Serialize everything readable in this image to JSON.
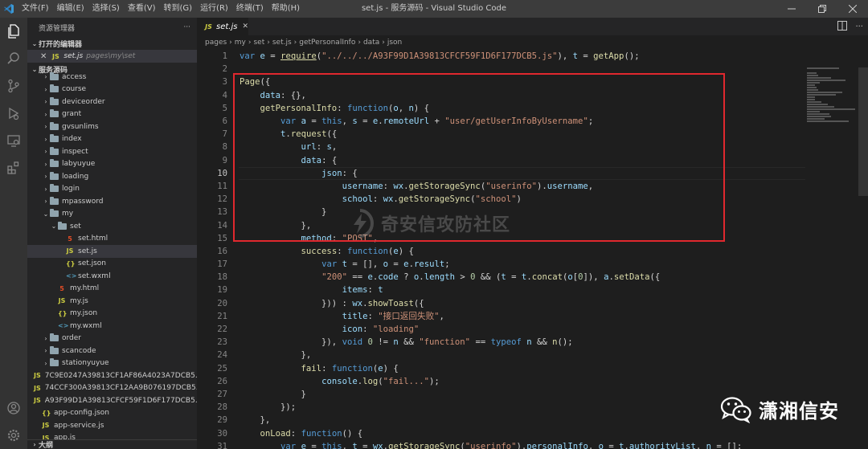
{
  "titlebar": {
    "menu": [
      "文件(F)",
      "编辑(E)",
      "选择(S)",
      "查看(V)",
      "转到(G)",
      "运行(R)",
      "终端(T)",
      "帮助(H)"
    ],
    "title": "set.js - 服务源码 - Visual Studio Code"
  },
  "sidebar": {
    "header": "资源管理器",
    "more": "···",
    "open_editors_label": "打开的编辑器",
    "open_editor": {
      "name": "set.js",
      "path": "pages\\my\\set"
    },
    "workspace_label": "服务源码",
    "tree": [
      {
        "label": "access",
        "type": "folder",
        "depth": 1
      },
      {
        "label": "course",
        "type": "folder",
        "depth": 1
      },
      {
        "label": "deviceorder",
        "type": "folder",
        "depth": 1
      },
      {
        "label": "grant",
        "type": "folder",
        "depth": 1
      },
      {
        "label": "gvsunlims",
        "type": "folder",
        "depth": 1
      },
      {
        "label": "index",
        "type": "folder",
        "depth": 1
      },
      {
        "label": "inspect",
        "type": "folder",
        "depth": 1
      },
      {
        "label": "labyuyue",
        "type": "folder",
        "depth": 1
      },
      {
        "label": "loading",
        "type": "folder",
        "depth": 1
      },
      {
        "label": "login",
        "type": "folder",
        "depth": 1
      },
      {
        "label": "mpassword",
        "type": "folder",
        "depth": 1
      },
      {
        "label": "my",
        "type": "folder-open",
        "depth": 1
      },
      {
        "label": "set",
        "type": "folder-open",
        "depth": 2
      },
      {
        "label": "set.html",
        "type": "html",
        "depth": 3
      },
      {
        "label": "set.js",
        "type": "js",
        "depth": 3,
        "selected": true
      },
      {
        "label": "set.json",
        "type": "json",
        "depth": 3
      },
      {
        "label": "set.wxml",
        "type": "wxml",
        "depth": 3
      },
      {
        "label": "my.html",
        "type": "html",
        "depth": 2
      },
      {
        "label": "my.js",
        "type": "js",
        "depth": 2
      },
      {
        "label": "my.json",
        "type": "json",
        "depth": 2
      },
      {
        "label": "my.wxml",
        "type": "wxml",
        "depth": 2
      },
      {
        "label": "order",
        "type": "folder",
        "depth": 1
      },
      {
        "label": "scancode",
        "type": "folder",
        "depth": 1
      },
      {
        "label": "stationyuyue",
        "type": "folder",
        "depth": 1
      },
      {
        "label": "7C9E0247A39813CF1AF86A4023A7DCB5...",
        "type": "js",
        "depth": 0
      },
      {
        "label": "74CCF300A39813CF12AA9B076197DCB5...",
        "type": "js",
        "depth": 0
      },
      {
        "label": "A93F99D1A39813CFCF59F1D6F177DCB5...",
        "type": "js",
        "depth": 0
      },
      {
        "label": "app-config.json",
        "type": "json",
        "depth": 0
      },
      {
        "label": "app-service.js",
        "type": "js",
        "depth": 0
      },
      {
        "label": "app.js",
        "type": "js",
        "depth": 0
      }
    ],
    "outline_label": "大纲"
  },
  "editor": {
    "tab": "set.js",
    "breadcrumbs": [
      "pages",
      "my",
      "set",
      "set.js",
      "getPersonalInfo",
      "data",
      "json"
    ],
    "current_line": 10,
    "lines": [
      {
        "n": "1",
        "tokens": [
          [
            "k",
            "var"
          ],
          [
            "p",
            " "
          ],
          [
            "v",
            "e"
          ],
          [
            "p",
            " = "
          ],
          [
            "f",
            "require"
          ],
          [
            "p",
            "("
          ],
          [
            "s",
            "\"../../../A93F99D1A39813CFCF59F1D6F177DCB5.js\""
          ],
          [
            "p",
            "), "
          ],
          [
            "v",
            "t"
          ],
          [
            "p",
            " = "
          ],
          [
            "f",
            "getApp"
          ],
          [
            "p",
            "();"
          ]
        ]
      },
      {
        "n": "2",
        "tokens": []
      },
      {
        "n": "3",
        "tokens": [
          [
            "f",
            "Page"
          ],
          [
            "p",
            "({"
          ]
        ]
      },
      {
        "n": "4",
        "tokens": [
          [
            "p",
            "    "
          ],
          [
            "v",
            "data"
          ],
          [
            "p",
            ": {},"
          ]
        ]
      },
      {
        "n": "5",
        "tokens": [
          [
            "p",
            "    "
          ],
          [
            "f",
            "getPersonalInfo"
          ],
          [
            "p",
            ": "
          ],
          [
            "k",
            "function"
          ],
          [
            "p",
            "("
          ],
          [
            "v",
            "o"
          ],
          [
            "p",
            ", "
          ],
          [
            "v",
            "n"
          ],
          [
            "p",
            ") {"
          ]
        ]
      },
      {
        "n": "6",
        "tokens": [
          [
            "p",
            "        "
          ],
          [
            "k",
            "var"
          ],
          [
            "p",
            " "
          ],
          [
            "v",
            "a"
          ],
          [
            "p",
            " = "
          ],
          [
            "k",
            "this"
          ],
          [
            "p",
            ", "
          ],
          [
            "v",
            "s"
          ],
          [
            "p",
            " = "
          ],
          [
            "v",
            "e"
          ],
          [
            "p",
            "."
          ],
          [
            "v",
            "remoteUrl"
          ],
          [
            "p",
            " + "
          ],
          [
            "s",
            "\"user/getUserInfoByUsername\""
          ],
          [
            "p",
            ";"
          ]
        ]
      },
      {
        "n": "7",
        "tokens": [
          [
            "p",
            "        "
          ],
          [
            "v",
            "t"
          ],
          [
            "p",
            "."
          ],
          [
            "f",
            "request"
          ],
          [
            "p",
            "({"
          ]
        ]
      },
      {
        "n": "8",
        "tokens": [
          [
            "p",
            "            "
          ],
          [
            "v",
            "url"
          ],
          [
            "p",
            ": "
          ],
          [
            "v",
            "s"
          ],
          [
            "p",
            ","
          ]
        ]
      },
      {
        "n": "9",
        "tokens": [
          [
            "p",
            "            "
          ],
          [
            "v",
            "data"
          ],
          [
            "p",
            ": {"
          ]
        ]
      },
      {
        "n": "10",
        "tokens": [
          [
            "p",
            "                "
          ],
          [
            "v",
            "json"
          ],
          [
            "p",
            ": {"
          ]
        ]
      },
      {
        "n": "11",
        "tokens": [
          [
            "p",
            "                    "
          ],
          [
            "v",
            "username"
          ],
          [
            "p",
            ": "
          ],
          [
            "v",
            "wx"
          ],
          [
            "p",
            "."
          ],
          [
            "f",
            "getStorageSync"
          ],
          [
            "p",
            "("
          ],
          [
            "s",
            "\"userinfo\""
          ],
          [
            "p",
            ")."
          ],
          [
            "v",
            "username"
          ],
          [
            "p",
            ","
          ]
        ]
      },
      {
        "n": "12",
        "tokens": [
          [
            "p",
            "                    "
          ],
          [
            "v",
            "school"
          ],
          [
            "p",
            ": "
          ],
          [
            "v",
            "wx"
          ],
          [
            "p",
            "."
          ],
          [
            "f",
            "getStorageSync"
          ],
          [
            "p",
            "("
          ],
          [
            "s",
            "\"school\""
          ],
          [
            "p",
            ")"
          ]
        ]
      },
      {
        "n": "13",
        "tokens": [
          [
            "p",
            "                }"
          ]
        ]
      },
      {
        "n": "14",
        "tokens": [
          [
            "p",
            "            },"
          ]
        ]
      },
      {
        "n": "15",
        "tokens": [
          [
            "p",
            "            "
          ],
          [
            "v",
            "method"
          ],
          [
            "p",
            ": "
          ],
          [
            "s",
            "\"POST\""
          ],
          [
            "p",
            ","
          ]
        ]
      },
      {
        "n": "16",
        "tokens": [
          [
            "p",
            "            "
          ],
          [
            "f",
            "success"
          ],
          [
            "p",
            ": "
          ],
          [
            "k",
            "function"
          ],
          [
            "p",
            "("
          ],
          [
            "v",
            "e"
          ],
          [
            "p",
            ") {"
          ]
        ]
      },
      {
        "n": "17",
        "tokens": [
          [
            "p",
            "                "
          ],
          [
            "k",
            "var"
          ],
          [
            "p",
            " "
          ],
          [
            "v",
            "t"
          ],
          [
            "p",
            " = [], "
          ],
          [
            "v",
            "o"
          ],
          [
            "p",
            " = "
          ],
          [
            "v",
            "e"
          ],
          [
            "p",
            "."
          ],
          [
            "v",
            "result"
          ],
          [
            "p",
            ";"
          ]
        ]
      },
      {
        "n": "18",
        "tokens": [
          [
            "p",
            "                "
          ],
          [
            "s",
            "\"200\""
          ],
          [
            "p",
            " == "
          ],
          [
            "v",
            "e"
          ],
          [
            "p",
            "."
          ],
          [
            "v",
            "code"
          ],
          [
            "p",
            " ? "
          ],
          [
            "v",
            "o"
          ],
          [
            "p",
            "."
          ],
          [
            "v",
            "length"
          ],
          [
            "p",
            " > "
          ],
          [
            "n",
            "0"
          ],
          [
            "p",
            " && ("
          ],
          [
            "v",
            "t"
          ],
          [
            "p",
            " = "
          ],
          [
            "v",
            "t"
          ],
          [
            "p",
            "."
          ],
          [
            "f",
            "concat"
          ],
          [
            "p",
            "("
          ],
          [
            "v",
            "o"
          ],
          [
            "p",
            "["
          ],
          [
            "n",
            "0"
          ],
          [
            "p",
            "]), "
          ],
          [
            "v",
            "a"
          ],
          [
            "p",
            "."
          ],
          [
            "f",
            "setData"
          ],
          [
            "p",
            "({"
          ]
        ]
      },
      {
        "n": "19",
        "tokens": [
          [
            "p",
            "                    "
          ],
          [
            "v",
            "items"
          ],
          [
            "p",
            ": "
          ],
          [
            "v",
            "t"
          ]
        ]
      },
      {
        "n": "20",
        "tokens": [
          [
            "p",
            "                })) : "
          ],
          [
            "v",
            "wx"
          ],
          [
            "p",
            "."
          ],
          [
            "f",
            "showToast"
          ],
          [
            "p",
            "({"
          ]
        ]
      },
      {
        "n": "21",
        "tokens": [
          [
            "p",
            "                    "
          ],
          [
            "v",
            "title"
          ],
          [
            "p",
            ": "
          ],
          [
            "s",
            "\"接口返回失败\""
          ],
          [
            "p",
            ","
          ]
        ]
      },
      {
        "n": "22",
        "tokens": [
          [
            "p",
            "                    "
          ],
          [
            "v",
            "icon"
          ],
          [
            "p",
            ": "
          ],
          [
            "s",
            "\"loading\""
          ]
        ]
      },
      {
        "n": "23",
        "tokens": [
          [
            "p",
            "                }), "
          ],
          [
            "k",
            "void"
          ],
          [
            "p",
            " "
          ],
          [
            "n",
            "0"
          ],
          [
            "p",
            " != "
          ],
          [
            "v",
            "n"
          ],
          [
            "p",
            " && "
          ],
          [
            "s",
            "\"function\""
          ],
          [
            "p",
            " == "
          ],
          [
            "k",
            "typeof"
          ],
          [
            "p",
            " "
          ],
          [
            "v",
            "n"
          ],
          [
            "p",
            " && "
          ],
          [
            "f",
            "n"
          ],
          [
            "p",
            "();"
          ]
        ]
      },
      {
        "n": "24",
        "tokens": [
          [
            "p",
            "            },"
          ]
        ]
      },
      {
        "n": "25",
        "tokens": [
          [
            "p",
            "            "
          ],
          [
            "f",
            "fail"
          ],
          [
            "p",
            ": "
          ],
          [
            "k",
            "function"
          ],
          [
            "p",
            "("
          ],
          [
            "v",
            "e"
          ],
          [
            "p",
            ") {"
          ]
        ]
      },
      {
        "n": "26",
        "tokens": [
          [
            "p",
            "                "
          ],
          [
            "v",
            "console"
          ],
          [
            "p",
            "."
          ],
          [
            "f",
            "log"
          ],
          [
            "p",
            "("
          ],
          [
            "s",
            "\"fail...\""
          ],
          [
            "p",
            ");"
          ]
        ]
      },
      {
        "n": "27",
        "tokens": [
          [
            "p",
            "            }"
          ]
        ]
      },
      {
        "n": "28",
        "tokens": [
          [
            "p",
            "        });"
          ]
        ]
      },
      {
        "n": "29",
        "tokens": [
          [
            "p",
            "    },"
          ]
        ]
      },
      {
        "n": "30",
        "tokens": [
          [
            "p",
            "    "
          ],
          [
            "f",
            "onLoad"
          ],
          [
            "p",
            ": "
          ],
          [
            "k",
            "function"
          ],
          [
            "p",
            "() {"
          ]
        ]
      },
      {
        "n": "31",
        "tokens": [
          [
            "p",
            "        "
          ],
          [
            "k",
            "var"
          ],
          [
            "p",
            " "
          ],
          [
            "v",
            "e"
          ],
          [
            "p",
            " = "
          ],
          [
            "k",
            "this"
          ],
          [
            "p",
            ", "
          ],
          [
            "v",
            "t"
          ],
          [
            "p",
            " = "
          ],
          [
            "v",
            "wx"
          ],
          [
            "p",
            "."
          ],
          [
            "f",
            "getStorageSync"
          ],
          [
            "p",
            "("
          ],
          [
            "s",
            "\"userinfo\""
          ],
          [
            "p",
            ")."
          ],
          [
            "v",
            "personalInfo"
          ],
          [
            "p",
            ", "
          ],
          [
            "v",
            "o"
          ],
          [
            "p",
            " = "
          ],
          [
            "v",
            "t"
          ],
          [
            "p",
            "."
          ],
          [
            "v",
            "authorityList"
          ],
          [
            "p",
            ", "
          ],
          [
            "v",
            "n"
          ],
          [
            "p",
            " = [];"
          ]
        ]
      }
    ]
  },
  "watermark_center": "奇安信攻防社区",
  "watermark_brand": "潇湘信安",
  "colors": {
    "highlight_box": "#e0282e",
    "keyword": "#569cd6",
    "function": "#dcdcaa",
    "variable": "#9cdcfe",
    "string": "#ce9178",
    "number": "#b5cea8"
  }
}
